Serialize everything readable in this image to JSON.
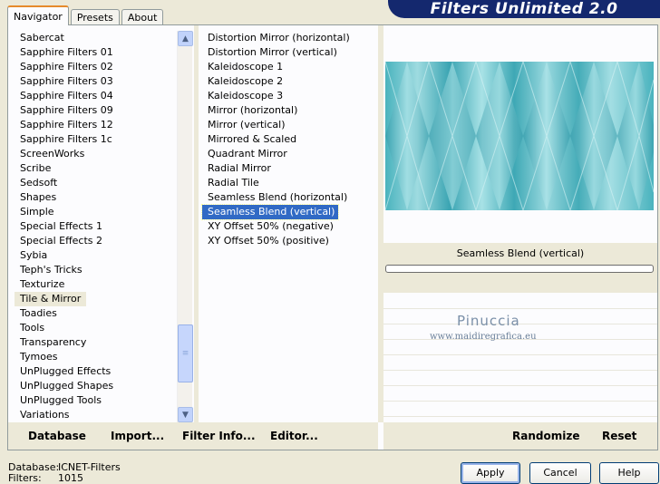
{
  "tabs": [
    {
      "label": "Navigator",
      "active": true
    },
    {
      "label": "Presets",
      "active": false
    },
    {
      "label": "About",
      "active": false
    }
  ],
  "banner": {
    "title": "Filters Unlimited 2.0"
  },
  "categories": {
    "items": [
      "Sabercat",
      "Sapphire Filters 01",
      "Sapphire Filters 02",
      "Sapphire Filters 03",
      "Sapphire Filters 04",
      "Sapphire Filters 09",
      "Sapphire Filters 12",
      "Sapphire Filters 1c",
      "ScreenWorks",
      "Scribe",
      "Sedsoft",
      "Shapes",
      "Simple",
      "Special Effects 1",
      "Special Effects 2",
      "Sybia",
      "Teph's Tricks",
      "Texturize",
      "Tile & Mirror",
      "Toadies",
      "Tools",
      "Transparency",
      "Tymoes",
      "UnPlugged Effects",
      "UnPlugged Shapes",
      "UnPlugged Tools",
      "Variations"
    ],
    "selected": "Tile & Mirror"
  },
  "filters": {
    "items": [
      "Distortion Mirror (horizontal)",
      "Distortion Mirror (vertical)",
      "Kaleidoscope 1",
      "Kaleidoscope 2",
      "Kaleidoscope 3",
      "Mirror (horizontal)",
      "Mirror (vertical)",
      "Mirrored & Scaled",
      "Quadrant Mirror",
      "Radial Mirror",
      "Radial Tile",
      "Seamless Blend (horizontal)",
      "Seamless Blend (vertical)",
      "XY Offset 50% (negative)",
      "XY Offset 50% (positive)"
    ],
    "selected": "Seamless Blend (vertical)"
  },
  "preview": {
    "caption": "Seamless Blend (vertical)",
    "progress": 0
  },
  "watermark": {
    "name": "Pinuccia",
    "url": "www.maidiregrafica.eu"
  },
  "toolbar_left": {
    "database": "Database",
    "import": "Import...",
    "filter_info": "Filter Info...",
    "editor": "Editor..."
  },
  "toolbar_right": {
    "randomize": "Randomize",
    "reset": "Reset"
  },
  "footer": {
    "database_label": "Database:",
    "database_value": "ICNET-Filters",
    "filters_label": "Filters:",
    "filters_value": "1015"
  },
  "buttons": {
    "apply": "Apply",
    "cancel": "Cancel",
    "help": "Help"
  },
  "colors": {
    "banner": "#14286e",
    "selection": "#316ac5",
    "tab_accent": "#e68b2c"
  }
}
